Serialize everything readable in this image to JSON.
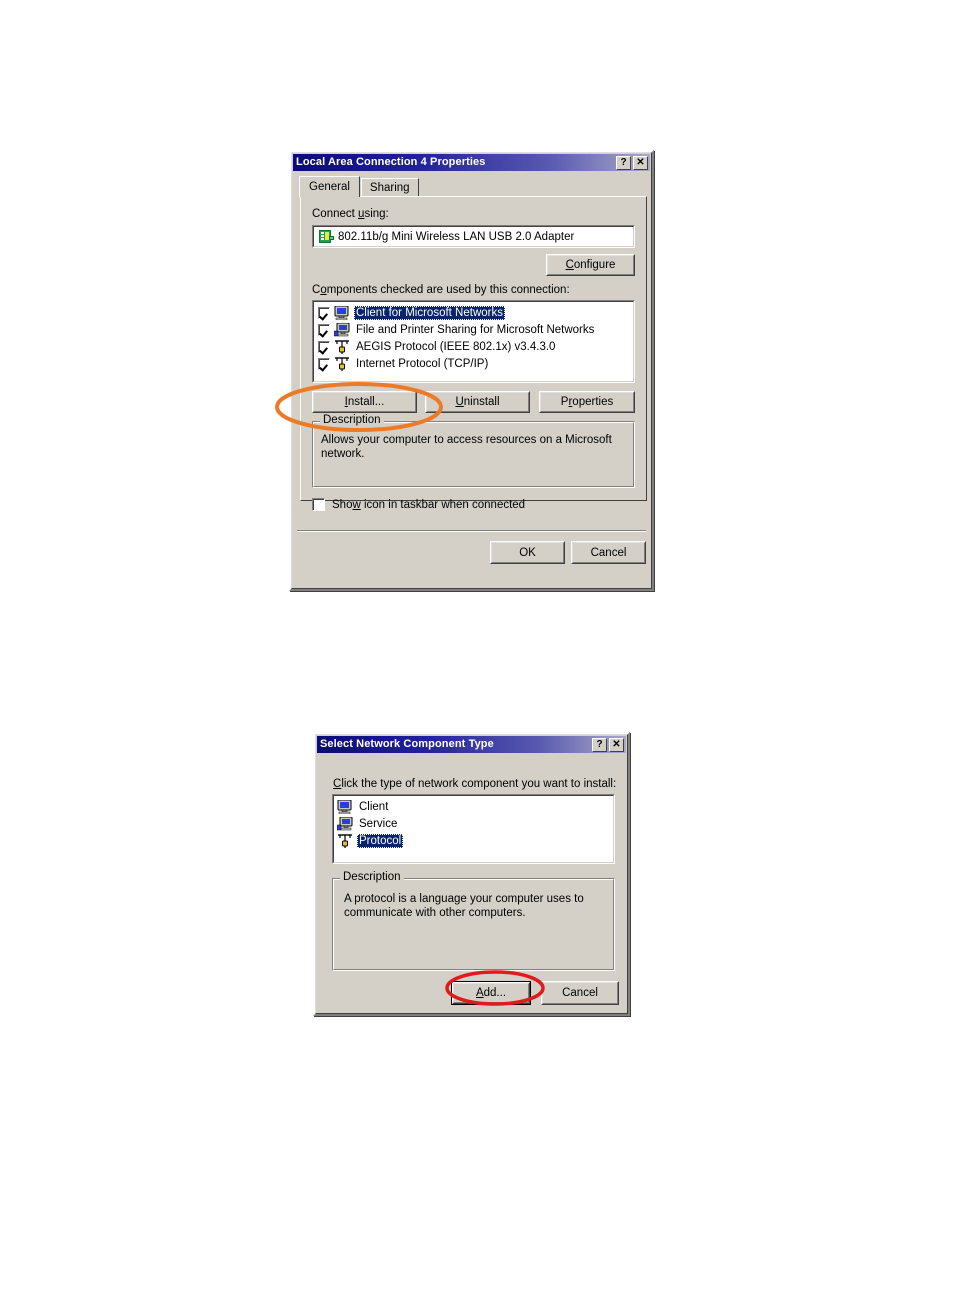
{
  "page": {
    "background": "#ffffff"
  },
  "dialog1": {
    "title": "Local Area Connection 4 Properties",
    "titlebar_buttons": [
      {
        "name": "help-button",
        "glyph": "?"
      },
      {
        "name": "close-button",
        "glyph": "✕"
      }
    ],
    "tabs": [
      {
        "label": "General",
        "active": true
      },
      {
        "label": "Sharing",
        "active": false
      }
    ],
    "connect_using_label": "Connect using:",
    "adapter": {
      "name": "802.11b/g Mini Wireless LAN USB 2.0 Adapter",
      "icon": "network-adapter-icon"
    },
    "configure_button": "Configure",
    "components_label": "Components checked are used by this connection:",
    "components": [
      {
        "label": "Client for Microsoft Networks",
        "checked": true,
        "selected": true,
        "icon": "client-monitor-icon"
      },
      {
        "label": "File and Printer Sharing for Microsoft Networks",
        "checked": true,
        "selected": false,
        "icon": "file-sharing-icon"
      },
      {
        "label": "AEGIS Protocol (IEEE 802.1x) v3.4.3.0",
        "checked": true,
        "selected": false,
        "icon": "protocol-plug-icon"
      },
      {
        "label": "Internet Protocol (TCP/IP)",
        "checked": true,
        "selected": false,
        "icon": "protocol-plug-icon"
      }
    ],
    "buttons": {
      "install": "Install...",
      "uninstall": "Uninstall",
      "properties": "Properties"
    },
    "description_group_label": "Description",
    "description_text": "Allows your computer to access resources on a Microsoft network.",
    "show_icon_checkbox": {
      "label": "Show icon in taskbar when connected",
      "checked": false
    },
    "footer_buttons": {
      "ok": "OK",
      "cancel": "Cancel"
    },
    "annotation": {
      "shape": "ellipse",
      "color": "#ED7A26",
      "target": "install-button"
    }
  },
  "dialog2": {
    "title": "Select Network Component Type",
    "titlebar_buttons": [
      {
        "name": "help-button",
        "glyph": "?"
      },
      {
        "name": "close-button",
        "glyph": "✕"
      }
    ],
    "prompt": "Click the type of network component you want to install:",
    "component_types": [
      {
        "label": "Client",
        "selected": false,
        "icon": "client-monitor-icon"
      },
      {
        "label": "Service",
        "selected": false,
        "icon": "service-monitor-icon"
      },
      {
        "label": "Protocol",
        "selected": true,
        "icon": "protocol-plug-icon"
      }
    ],
    "description_group_label": "Description",
    "description_text": "A protocol is a language your computer uses to communicate with other computers.",
    "footer_buttons": {
      "add": "Add...",
      "cancel": "Cancel"
    },
    "annotation": {
      "shape": "ellipse",
      "color": "#E01B1B",
      "target": "add-button"
    }
  }
}
